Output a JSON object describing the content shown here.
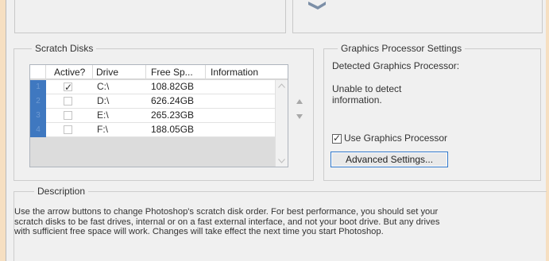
{
  "scratch_disks": {
    "legend": "Scratch Disks",
    "columns": [
      "Active?",
      "Drive",
      "Free Sp...",
      "Information"
    ],
    "rows": [
      {
        "index": "1",
        "active": true,
        "drive": "C:\\",
        "free": "108.82GB",
        "info": ""
      },
      {
        "index": "2",
        "active": false,
        "drive": "D:\\",
        "free": "626.24GB",
        "info": ""
      },
      {
        "index": "3",
        "active": false,
        "drive": "E:\\",
        "free": "265.23GB",
        "info": ""
      },
      {
        "index": "4",
        "active": false,
        "drive": "F:\\",
        "free": "188.05GB",
        "info": ""
      }
    ]
  },
  "gpu": {
    "legend": "Graphics Processor Settings",
    "detected_label": "Detected Graphics Processor:",
    "status_line1": "Unable to detect",
    "status_line2": "information.",
    "use_gpu_label": "Use Graphics Processor",
    "use_gpu_checked": true,
    "advanced_button": "Advanced Settings..."
  },
  "description": {
    "legend": "Description",
    "line1": "Use the arrow buttons to change Photoshop's scratch disk order. For best performance, you should set your",
    "line2": "scratch disks to be fast drives, internal or on a fast external interface, and not your boot drive. But any drives",
    "line3": "with sufficient free space will work. Changes will take effect the next time you start Photoshop."
  },
  "colors": {
    "background": "#f6dfc1",
    "panel": "#f0f0f0",
    "index_column": "#3f78c0",
    "button_border": "#2f76c8"
  },
  "icons": [
    "pointer-icon",
    "scroll-up-icon",
    "scroll-down-icon",
    "move-up-icon",
    "move-down-icon",
    "check-icon"
  ]
}
